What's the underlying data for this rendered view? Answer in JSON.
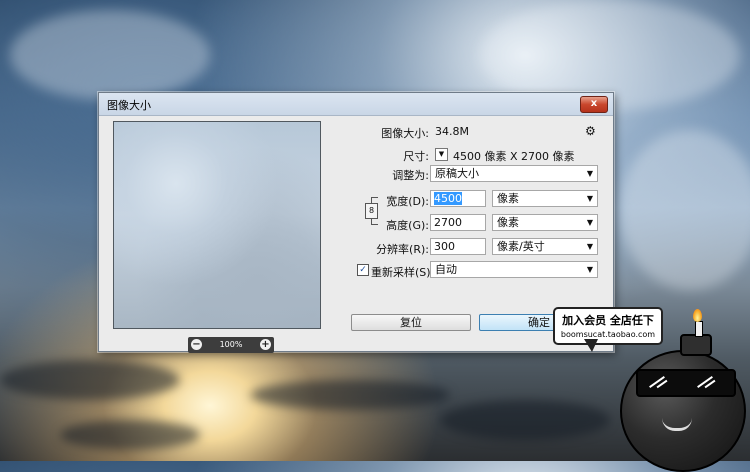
{
  "dialog": {
    "title": "图像大小",
    "close_label": "x",
    "preview": {
      "zoom_out": "−",
      "zoom_in": "+",
      "zoom_level": "100%"
    },
    "image_size": {
      "label": "图像大小:",
      "value": "34.8M"
    },
    "dimensions": {
      "label": "尺寸:",
      "value": "4500 像素  X  2700 像素"
    },
    "fit_to": {
      "label": "调整为:",
      "value": "原稿大小"
    },
    "width": {
      "label": "宽度(D):",
      "value": "4500",
      "unit": "像素"
    },
    "height": {
      "label": "高度(G):",
      "value": "2700",
      "unit": "像素"
    },
    "resolution": {
      "label": "分辨率(R):",
      "value": "300",
      "unit": "像素/英寸"
    },
    "resample": {
      "label": "重新采样(S):",
      "checked": true,
      "value": "自动"
    },
    "reset_button": "复位",
    "ok_button": "确定"
  },
  "promo": {
    "title": "加入会员 全店任下",
    "url": "boomsucat.taobao.com"
  },
  "colors": {
    "titlebar": "#c9d6e6",
    "close": "#c9462c",
    "selection": "#3399ff"
  },
  "icons": [
    "gear-icon",
    "link-icon",
    "zoom-out-icon",
    "zoom-in-icon",
    "chevron-down-icon",
    "checkbox-icon"
  ]
}
